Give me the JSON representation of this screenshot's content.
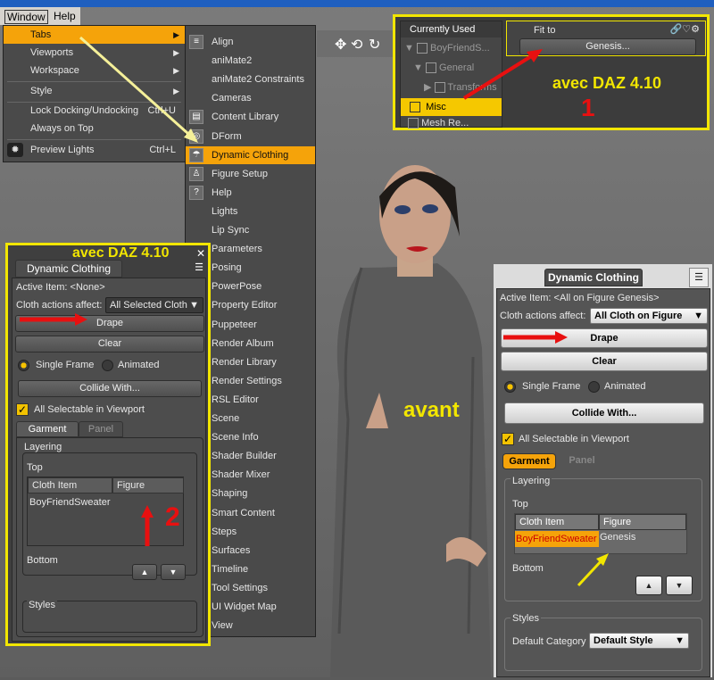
{
  "menubar": {
    "window": "Window",
    "help": "Help"
  },
  "window_menu": [
    {
      "label": "Tabs",
      "arrow": "▶",
      "highlighted": true
    },
    {
      "label": "Viewports",
      "arrow": "▶"
    },
    {
      "label": "Workspace",
      "arrow": "▶"
    },
    {
      "label": "Style",
      "arrow": "▶"
    },
    {
      "label": "Lock Docking/Undocking",
      "shortcut": "Ctrl+U"
    },
    {
      "label": "Always on Top"
    },
    {
      "label": "Preview Lights",
      "shortcut": "Ctrl+L"
    }
  ],
  "tabs_menu": [
    "Align",
    "aniMate2",
    "aniMate2 Constraints",
    "Cameras",
    "Content Library",
    "DForm",
    "Dynamic Clothing",
    "Figure Setup",
    "Help",
    "Lights",
    "Lip Sync",
    "Parameters",
    "Posing",
    "PowerPose",
    "Property Editor",
    "Puppeteer",
    "Render Album",
    "Render Library",
    "Render Settings",
    "RSL Editor",
    "Scene",
    "Scene Info",
    "Shader Builder",
    "Shader Mixer",
    "Shaping",
    "Smart Content",
    "Steps",
    "Surfaces",
    "Timeline",
    "Tool Settings",
    "UI Widget Map",
    "View"
  ],
  "tabs_menu_highlight": "Dynamic Clothing",
  "top_right": {
    "currently_used": "Currently Used",
    "tree": [
      "BoyFriendS...",
      "General",
      "Transforms",
      "Misc",
      "Mesh Re..."
    ],
    "selected": "Misc",
    "fit_to_label": "Fit to",
    "fit_to_value": "Genesis...",
    "annotation": "avec DAZ 4.10",
    "number": "1"
  },
  "left_panel": {
    "annotation": "avec DAZ 4.10",
    "title": "Dynamic Clothing",
    "active_item": "Active Item: <None>",
    "cloth_actions_label": "Cloth actions affect:",
    "cloth_actions_value": "All Selected Cloth",
    "drape": "Drape",
    "clear": "Clear",
    "single_frame": "Single Frame",
    "animated": "Animated",
    "collide_with": "Collide With...",
    "all_selectable": "All Selectable in Viewport",
    "tab_garment": "Garment",
    "tab_panel": "Panel",
    "layering": "Layering",
    "top": "Top",
    "col_cloth_item": "Cloth Item",
    "col_figure": "Figure",
    "row_cloth": "BoyFriendSweater",
    "row_figure": "",
    "bottom": "Bottom",
    "styles": "Styles",
    "number": "2"
  },
  "viewport_label": "avant",
  "right_panel": {
    "title": "Dynamic Clothing",
    "active_item": "Active Item: <All on Figure Genesis>",
    "cloth_actions_label": "Cloth actions affect:",
    "cloth_actions_value": "All Cloth on Figure",
    "drape": "Drape",
    "clear": "Clear",
    "single_frame": "Single Frame",
    "animated": "Animated",
    "collide_with": "Collide With...",
    "all_selectable": "All Selectable in Viewport",
    "tab_garment": "Garment",
    "tab_panel": "Panel",
    "layering": "Layering",
    "top": "Top",
    "col_cloth_item": "Cloth Item",
    "col_figure": "Figure",
    "row_cloth": "BoyFriendSweater",
    "row_figure": "Genesis",
    "bottom": "Bottom",
    "styles": "Styles",
    "default_category_label": "Default Category",
    "default_category_value": "Default Style"
  },
  "colors": {
    "highlight": "#f5a30a",
    "annotation_yellow": "#f2e600",
    "arrow_red": "#e81010"
  }
}
